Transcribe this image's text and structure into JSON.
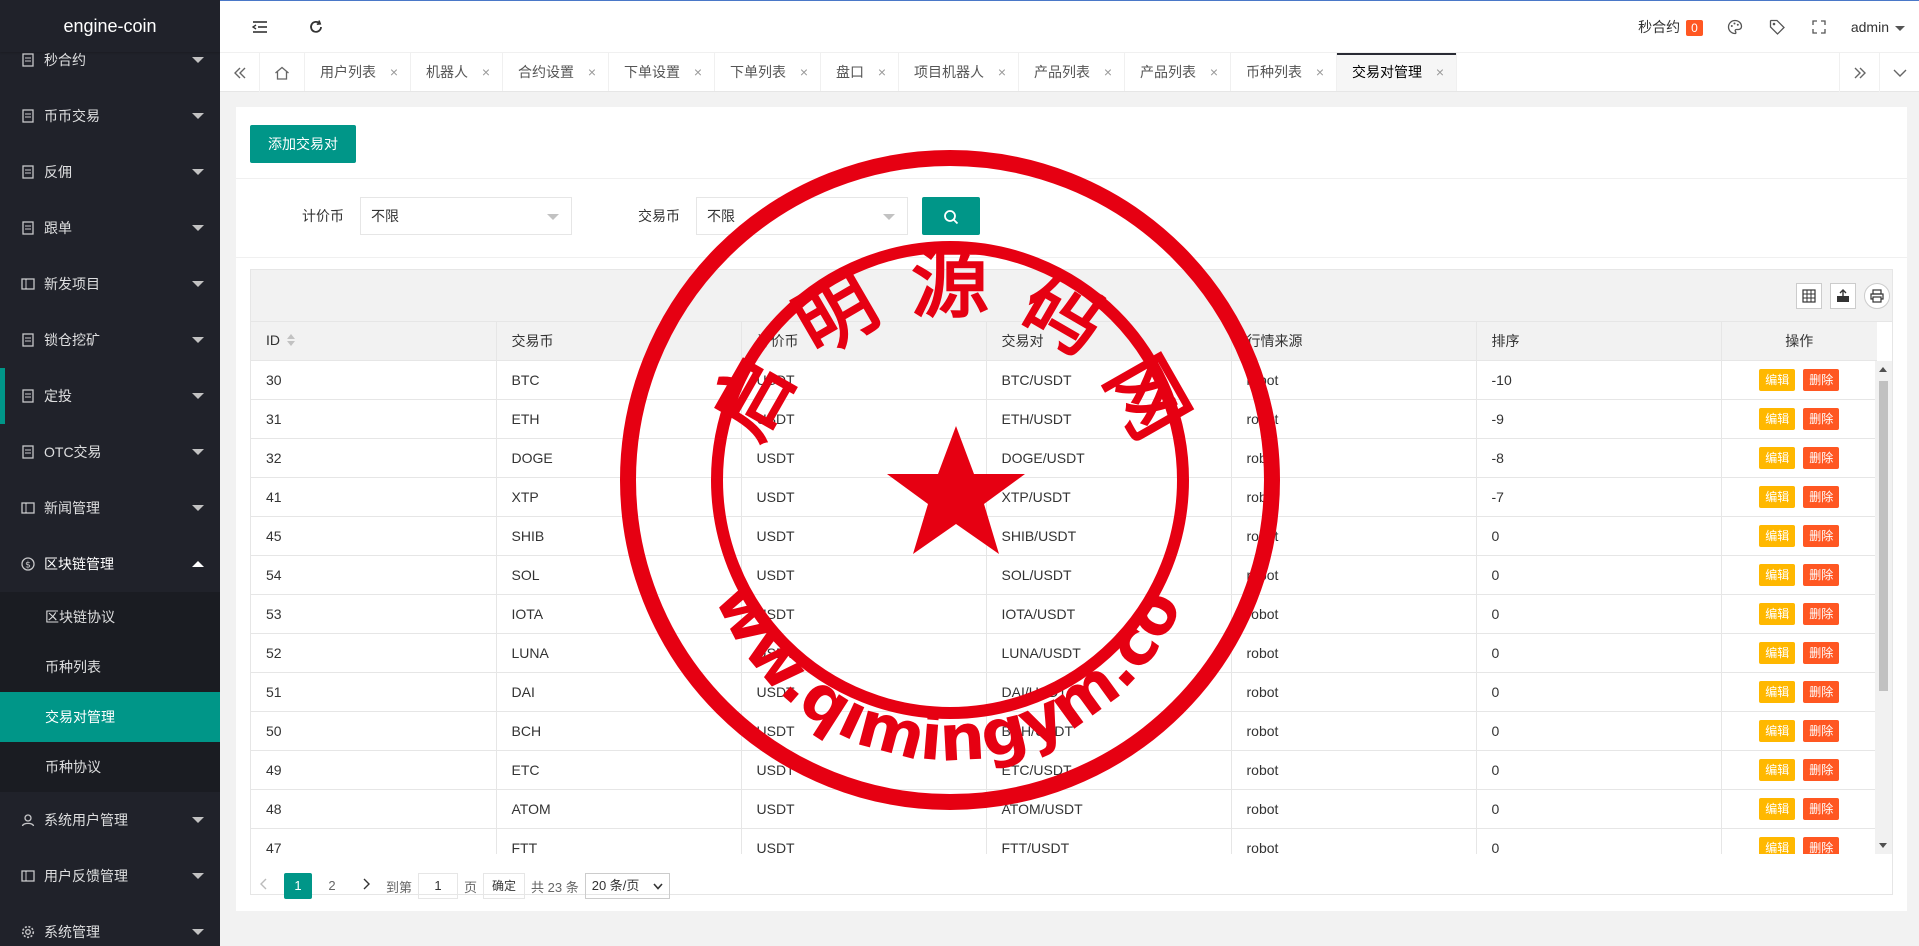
{
  "app": {
    "title": "engine-coin"
  },
  "sidebar": {
    "items": [
      {
        "label": "秒合约",
        "icon": "doc-icon"
      },
      {
        "label": "币币交易",
        "icon": "doc-icon"
      },
      {
        "label": "反佣",
        "icon": "doc-icon"
      },
      {
        "label": "跟单",
        "icon": "doc-icon"
      },
      {
        "label": "新发项目",
        "icon": "list-icon"
      },
      {
        "label": "锁仓挖矿",
        "icon": "doc-icon"
      },
      {
        "label": "定投",
        "icon": "doc-icon"
      },
      {
        "label": "OTC交易",
        "icon": "doc-icon"
      },
      {
        "label": "新闻管理",
        "icon": "list-icon"
      },
      {
        "label": "区块链管理",
        "icon": "dollar-icon"
      },
      {
        "label": "系统用户管理",
        "icon": "user-icon"
      },
      {
        "label": "用户反馈管理",
        "icon": "list-icon"
      },
      {
        "label": "系统管理",
        "icon": "gear-icon"
      }
    ],
    "sub_items": [
      "区块链协议",
      "币种列表",
      "交易对管理",
      "币种协议"
    ]
  },
  "header": {
    "contract_label": "秒合约",
    "contract_count": "0",
    "user": "admin"
  },
  "tabs": [
    "用户列表",
    "机器人",
    "合约设置",
    "下单设置",
    "下单列表",
    "盘口",
    "项目机器人",
    "产品列表",
    "产品列表",
    "币种列表",
    "交易对管理"
  ],
  "tab_close": "×",
  "page": {
    "add_button": "添加交易对",
    "filter_quote_label": "计价币",
    "filter_quote_value": "不限",
    "filter_trade_label": "交易币",
    "filter_trade_value": "不限"
  },
  "table": {
    "columns": [
      "ID",
      "交易币",
      "计价币",
      "交易对",
      "行情来源",
      "排序",
      "操作"
    ],
    "edit_label": "编辑",
    "delete_label": "删除",
    "rows": [
      [
        "30",
        "BTC",
        "USDT",
        "BTC/USDT",
        "robot",
        "-10"
      ],
      [
        "31",
        "ETH",
        "USDT",
        "ETH/USDT",
        "robot",
        "-9"
      ],
      [
        "32",
        "DOGE",
        "USDT",
        "DOGE/USDT",
        "robot",
        "-8"
      ],
      [
        "41",
        "XTP",
        "USDT",
        "XTP/USDT",
        "robot",
        "-7"
      ],
      [
        "45",
        "SHIB",
        "USDT",
        "SHIB/USDT",
        "robot",
        "0"
      ],
      [
        "54",
        "SOL",
        "USDT",
        "SOL/USDT",
        "robot",
        "0"
      ],
      [
        "53",
        "IOTA",
        "USDT",
        "IOTA/USDT",
        "robot",
        "0"
      ],
      [
        "52",
        "LUNA",
        "USDT",
        "LUNA/USDT",
        "robot",
        "0"
      ],
      [
        "51",
        "DAI",
        "USDT",
        "DAI/USDT",
        "robot",
        "0"
      ],
      [
        "50",
        "BCH",
        "USDT",
        "BCH/USDT",
        "robot",
        "0"
      ],
      [
        "49",
        "ETC",
        "USDT",
        "ETC/USDT",
        "robot",
        "0"
      ],
      [
        "48",
        "ATOM",
        "USDT",
        "ATOM/USDT",
        "robot",
        "0"
      ],
      [
        "47",
        "FTT",
        "USDT",
        "FTT/USDT",
        "robot",
        "0"
      ]
    ]
  },
  "pager": {
    "page1": "1",
    "page2": "2",
    "goto_label": "到第",
    "goto_value": "1",
    "page_unit": "页",
    "confirm": "确定",
    "total": "共 23 条",
    "page_size": "20 条/页"
  },
  "watermark": {
    "top_text": "启 明 源 码 网",
    "bottom_text": "www.qimingym.com",
    "color": "#e60012"
  },
  "colors": {
    "accent": "#009688",
    "sidebar": "#20222a",
    "edit": "#ffb800",
    "delete": "#ff5722"
  }
}
